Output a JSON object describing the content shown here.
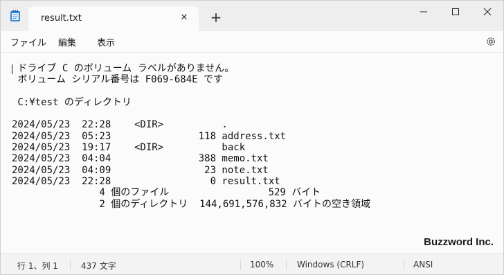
{
  "tab": {
    "title": "result.txt"
  },
  "menu": {
    "file": "ファイル",
    "edit": "編集",
    "view": "表示"
  },
  "editor": {
    "lines": [
      " ドライブ C のボリューム ラベルがありません。",
      " ボリューム シリアル番号は F069-684E です",
      "",
      " C:¥test のディレクトリ",
      "",
      "2024/05/23  22:28    <DIR>          .",
      "2024/05/23  05:23               118 address.txt",
      "2024/05/23  19:17    <DIR>          back",
      "2024/05/23  04:04               388 memo.txt",
      "2024/05/23  04:09                23 note.txt",
      "2024/05/23  22:28                 0 result.txt",
      "               4 個のファイル                 529 バイト",
      "               2 個のディレクトリ  144,691,576,832 バイトの空き領域"
    ]
  },
  "watermark": "Buzzword Inc.",
  "status": {
    "position": "行 1、列 1",
    "chars": "437 文字",
    "zoom": "100%",
    "line_ending": "Windows (CRLF)",
    "encoding": "ANSI"
  }
}
